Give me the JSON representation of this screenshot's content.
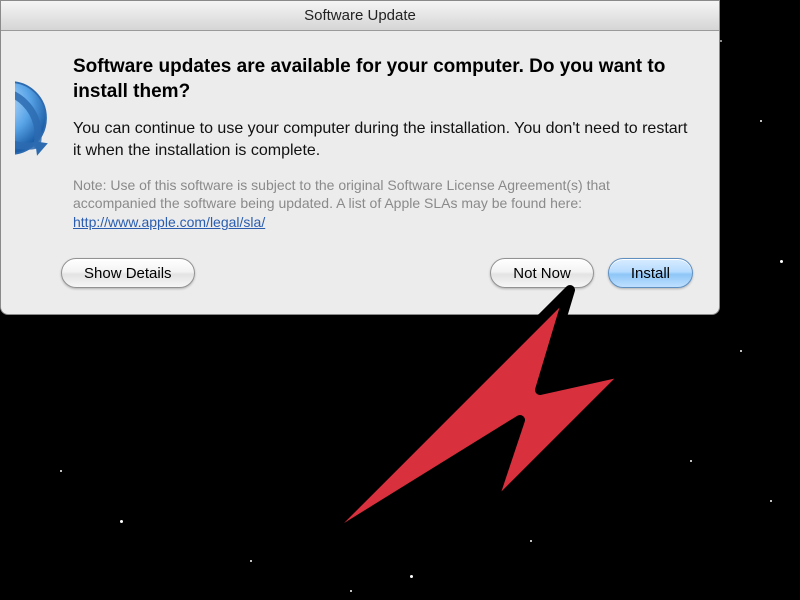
{
  "titlebar": {
    "title": "Software Update"
  },
  "dialog": {
    "heading": "Software updates are available for your computer. Do you want to install them?",
    "subtext": "You can continue to use your computer during the installation. You don't need to restart it when the installation is complete.",
    "note_prefix": "Note: Use of this software is subject to the original Software License Agreement(s) that accompanied the software being updated. A list of Apple SLAs may be found here: ",
    "note_link_text": "http://www.apple.com/legal/sla/",
    "note_link_href": "http://www.apple.com/legal/sla/"
  },
  "buttons": {
    "show_details": "Show Details",
    "not_now": "Not Now",
    "install": "Install"
  },
  "icons": {
    "update_globe": "software-update-globe-icon"
  },
  "overlay": {
    "arrow": "instructional-red-arrow"
  }
}
